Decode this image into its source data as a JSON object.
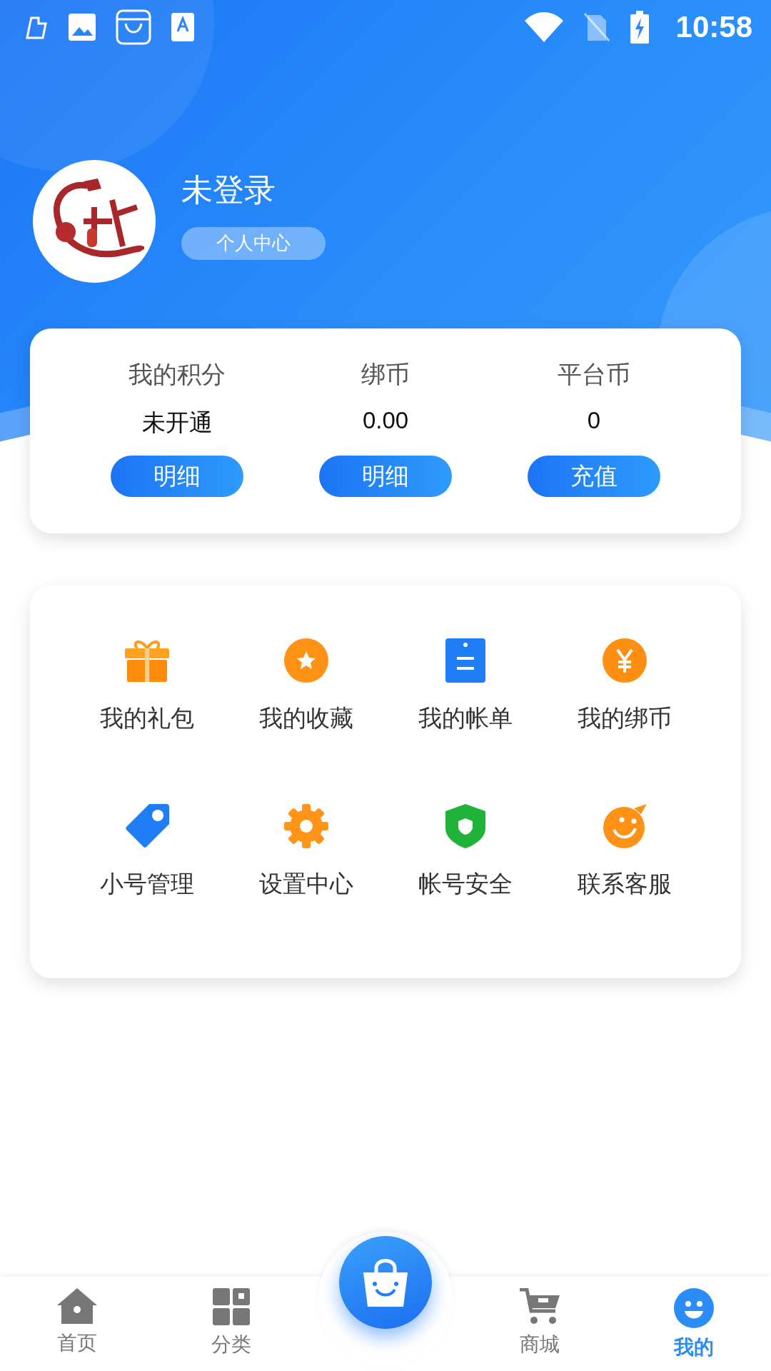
{
  "status_bar": {
    "time": "10:58"
  },
  "profile": {
    "name": "未登录",
    "badge": "个人中心"
  },
  "stats": [
    {
      "label": "我的积分",
      "value": "未开通",
      "action": "明细"
    },
    {
      "label": "绑币",
      "value": "0.00",
      "action": "明细"
    },
    {
      "label": "平台币",
      "value": "0",
      "action": "充值"
    }
  ],
  "menu": [
    {
      "label": "我的礼包",
      "kind": "gift"
    },
    {
      "label": "我的收藏",
      "kind": "star"
    },
    {
      "label": "我的帐单",
      "kind": "bill"
    },
    {
      "label": "我的绑币",
      "kind": "yen"
    },
    {
      "label": "小号管理",
      "kind": "tag"
    },
    {
      "label": "设置中心",
      "kind": "gear"
    },
    {
      "label": "帐号安全",
      "kind": "shield"
    },
    {
      "label": "联系客服",
      "kind": "smile"
    }
  ],
  "tabs": [
    {
      "label": "首页",
      "kind": "home",
      "selected": false
    },
    {
      "label": "分类",
      "kind": "grid",
      "selected": false
    },
    {
      "kind": "center",
      "selected": false
    },
    {
      "label": "商城",
      "kind": "cart",
      "selected": false
    },
    {
      "label": "我的",
      "kind": "me",
      "selected": true
    }
  ]
}
